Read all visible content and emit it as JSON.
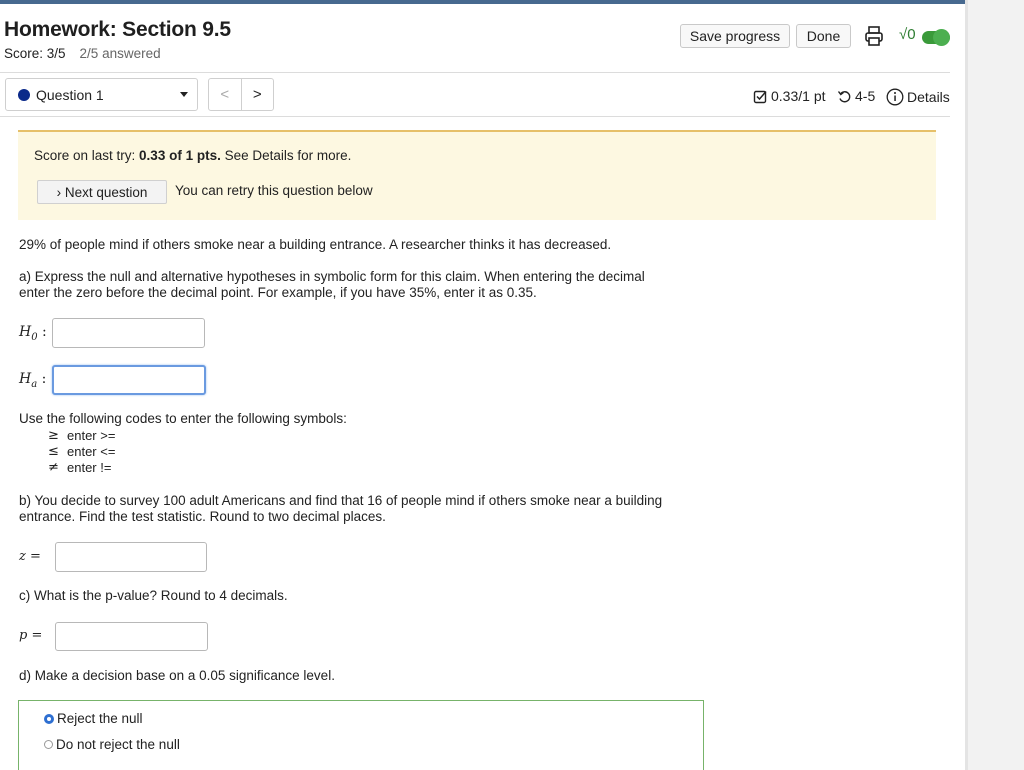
{
  "header": {
    "title": "Homework: Section 9.5",
    "score": "Score: 3/5",
    "answered": "2/5 answered",
    "save_label": "Save progress",
    "done_label": "Done",
    "sqrt_label": "√0"
  },
  "question_nav": {
    "selected": "Question 1",
    "prev": "<",
    "next": ">"
  },
  "meta": {
    "points": "0.33/1 pt",
    "attempts": "4-5",
    "details": "Details"
  },
  "notice": {
    "score_prefix": "Score on last try: ",
    "score_value": "0.33 of 1 pts.",
    "score_suffix": " See Details for more.",
    "next_label": "› Next question",
    "retry_text": "You can retry this question below"
  },
  "question": {
    "intro": "29% of people mind if others smoke near a building entrance. A researcher thinks it has decreased.",
    "part_a_line1": "a) Express the null and alternative hypotheses in symbolic form for this claim. When entering the decimal",
    "part_a_line2": "enter the zero before the decimal point. For example, if you have 35%, enter it as 0.35.",
    "h0_label": "H",
    "h0_sub": "0",
    "ha_label": "H",
    "ha_sub": "a",
    "h0_value": "",
    "ha_value": "",
    "codes_intro": "Use the following codes to enter the following symbols:",
    "codes": [
      {
        "symbol": "≥",
        "text": "enter >="
      },
      {
        "symbol": "≤",
        "text": "enter <="
      },
      {
        "symbol": "≠",
        "text": "enter !="
      }
    ],
    "part_b_line1": "b) You decide to survey 100 adult Americans and find that 16 of people mind if others smoke near a building",
    "part_b_line2": "entrance. Find the test statistic. Round to two decimal places.",
    "z_label": "z =",
    "z_value": "",
    "part_c": "c) What is the p-value? Round to 4 decimals.",
    "p_label": "p =",
    "p_value": "",
    "part_d": "d) Make a decision base on a 0.05 significance level.",
    "options": [
      {
        "label": "Reject the null",
        "checked": true
      },
      {
        "label": "Do not reject the null",
        "checked": false
      }
    ]
  },
  "colors": {
    "topbar": "#47698f",
    "notice_bg": "#fdf8e1",
    "notice_border": "#e6c069",
    "focus_ring": "#6a9ae0",
    "correct_border": "#77b36a",
    "radio_selected": "#2e6fd1"
  }
}
